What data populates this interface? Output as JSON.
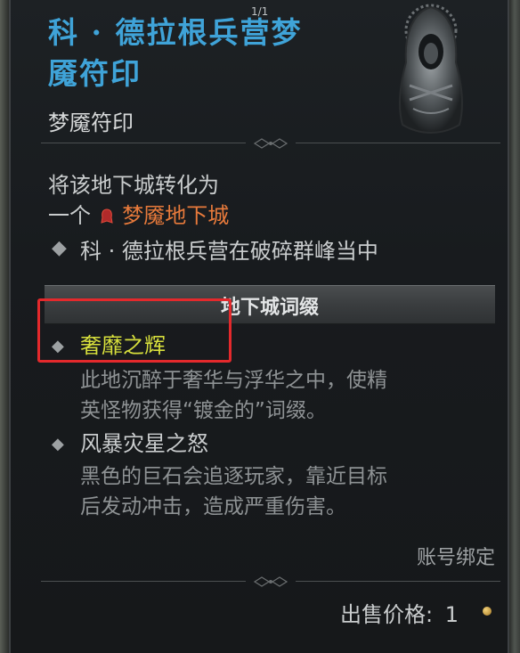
{
  "item": {
    "page_indicator": "1/1",
    "title_line1": "科 · 德拉根兵营梦",
    "title_line2": "魇符印",
    "subtitle": "梦魇符印",
    "description_line1": "将该地下城转化为",
    "description_line2_prefix": "一个",
    "dungeon_type": "梦魇地下城",
    "location": "科 · 德拉根兵营在破碎群峰当中"
  },
  "affixes": {
    "header": "地下城词缀",
    "list": [
      {
        "name": "奢靡之辉",
        "name_color": "#d7df3c",
        "desc_line1": "此地沉醉于奢华与浮华之中，使精",
        "desc_line2": "英怪物获得“镀金的”词缀。"
      },
      {
        "name": "风暴灾星之怒",
        "name_color": "#c9cccd",
        "desc_line1": "黑色的巨石会追逐玩家，靠近目标",
        "desc_line2": "后发动冲击，造成严重伤害。"
      }
    ]
  },
  "footer": {
    "account_bound": "账号绑定",
    "sell_price_label": "出售价格:",
    "sell_price_value": "1"
  },
  "colors": {
    "title": "#3fa3d8",
    "dungeon_type": "#e87a3b",
    "highlight": "#e4292c",
    "coin": "#d6a94a"
  },
  "icons": {
    "sigil": "hooded-statue-sigil-icon",
    "dungeon_marker": "nightmare-marker-icon",
    "bullet": "diamond-bullet-icon",
    "coin": "gold-coin-icon"
  }
}
